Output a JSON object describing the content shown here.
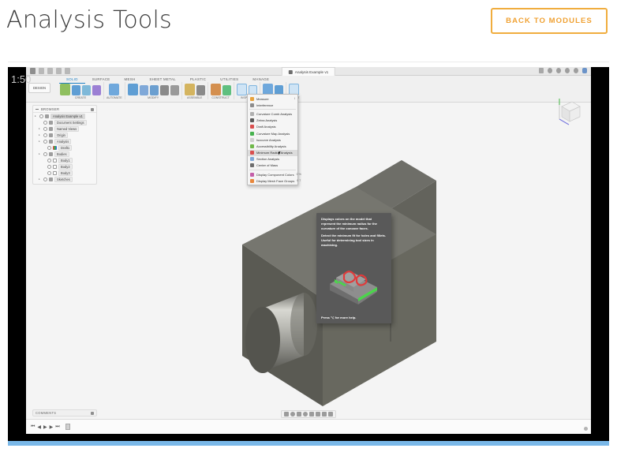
{
  "header": {
    "title": "Analysis Tools",
    "back_button": "Back to Modules",
    "accent_color": "#f0ad3e"
  },
  "video": {
    "timestamp": "1:50",
    "progress_percent": 100,
    "progress_color": "#7ab8e8"
  },
  "fusion": {
    "document_tab": "Analysis Example v1",
    "design_chip": "DESIGN",
    "ribbon_tabs": [
      {
        "label": "SOLID",
        "active": true
      },
      {
        "label": "SURFACE",
        "active": false
      },
      {
        "label": "MESH",
        "active": false
      },
      {
        "label": "SHEET METAL",
        "active": false
      },
      {
        "label": "PLASTIC",
        "active": false
      },
      {
        "label": "UTILITIES",
        "active": false
      },
      {
        "label": "MANAGE",
        "active": false
      }
    ],
    "ribbon_panels": [
      {
        "label": "CREATE"
      },
      {
        "label": "AUTOMATE"
      },
      {
        "label": "MODIFY"
      },
      {
        "label": "ASSEMBLE"
      },
      {
        "label": "CONSTRUCT"
      },
      {
        "label": "INSPECT"
      },
      {
        "label": "INSERT"
      },
      {
        "label": "SELECT"
      }
    ],
    "browser": {
      "title": "BROWSER",
      "nodes": [
        {
          "label": "Analysis Example v1",
          "indent": 0,
          "kind": "root",
          "selected": true
        },
        {
          "label": "Document Settings",
          "indent": 1,
          "kind": "settings"
        },
        {
          "label": "Named Views",
          "indent": 1,
          "kind": "folder"
        },
        {
          "label": "Origin",
          "indent": 1,
          "kind": "folder"
        },
        {
          "label": "Analysis",
          "indent": 1,
          "kind": "folder"
        },
        {
          "label": "Draft1",
          "indent": 2,
          "kind": "swatch"
        },
        {
          "label": "Bodies",
          "indent": 1,
          "kind": "folder"
        },
        {
          "label": "Body1",
          "indent": 2,
          "kind": "body"
        },
        {
          "label": "Body2",
          "indent": 2,
          "kind": "body"
        },
        {
          "label": "Body3",
          "indent": 2,
          "kind": "body"
        },
        {
          "label": "Sketches",
          "indent": 1,
          "kind": "folder"
        }
      ]
    },
    "inspect_menu": {
      "open": true,
      "header": "INSPECT",
      "items": [
        {
          "label": "Measure",
          "shortcut": "I",
          "color": "#e8a33d"
        },
        {
          "label": "Interference",
          "shortcut": "",
          "color": "#8c8c8c"
        },
        {
          "sep": true
        },
        {
          "label": "Curvature Comb Analysis",
          "shortcut": "",
          "color": "#b0b0b0"
        },
        {
          "label": "Zebra Analysis",
          "shortcut": "",
          "color": "#5a5a5a"
        },
        {
          "label": "Draft Analysis",
          "shortcut": "",
          "color": "#d94f4f"
        },
        {
          "label": "Curvature Map Analysis",
          "shortcut": "",
          "color": "#47b24f"
        },
        {
          "label": "Isocurve Analysis",
          "shortcut": "",
          "color": "#cfcfcf"
        },
        {
          "label": "Accessibility Analysis",
          "shortcut": "",
          "color": "#6fb84a"
        },
        {
          "label": "Minimum Radius Analysis",
          "shortcut": "",
          "color": "#d94f4f",
          "highlighted": true
        },
        {
          "label": "Section Analysis",
          "shortcut": "",
          "color": "#7fa8d8"
        },
        {
          "label": "Center of Mass",
          "shortcut": "",
          "color": "#6e6e6e"
        },
        {
          "sep": true
        },
        {
          "label": "Display Component Colors",
          "shortcut": "0 %",
          "color": "#c45fa8"
        },
        {
          "label": "Display Mesh Face Groups",
          "shortcut": "0 7",
          "color": "#e8883d"
        }
      ]
    },
    "tooltip": {
      "paragraph1": "Displays colors on the model that represent the minimum radius for the curvature of the concave faces.",
      "paragraph2": "Detect the minimum fit for holes and fillets. Useful for determining tool sizes in machining.",
      "footer": "Press ⌥ for more help."
    },
    "comments_panel": "COMMENTS"
  }
}
